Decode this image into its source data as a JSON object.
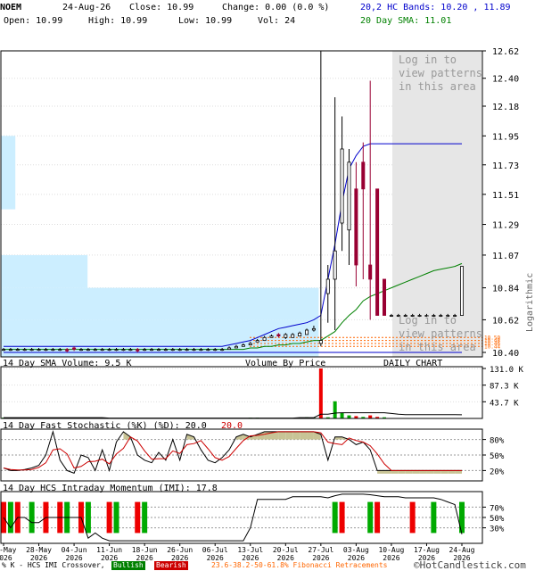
{
  "header": {
    "symbol": "NOEM",
    "date": "24-Aug-26",
    "close": "Close: 10.99",
    "change": "Change: 0.00 (0.0 %)",
    "open": "Open: 10.99",
    "high": "High: 10.99",
    "low": "Low: 10.99",
    "vol": "Vol: 24",
    "bands": "20,2 HC Bands: 10.20 , 11.89",
    "sma": "20 Day SMA: 11.01"
  },
  "panels": {
    "price": {
      "axis_label": "Logarithmic",
      "overlay_text": [
        "Log in to",
        "view patterns",
        "in this area"
      ],
      "y_ticks": [
        "12.62",
        "12.40",
        "12.18",
        "11.95",
        "11.73",
        "11.51",
        "11.29",
        "11.07",
        "10.84",
        "10.62",
        "10.40"
      ],
      "fib_labels": [
        "10.50",
        "10.48",
        "10.46",
        "10.44"
      ]
    },
    "volume": {
      "title": "14 Day SMA Volume: 9.5 K",
      "vbp_label": "Volume By Price",
      "daily_label": "DAILY CHART",
      "y_ticks": [
        "131.0 K",
        "87.3 K",
        "43.7 K"
      ]
    },
    "stochastic": {
      "title": "14 Day Fast Stochastic (%K) (%D): 20.0",
      "title_value": "20.0",
      "y_ticks": [
        "80%",
        "50%",
        "20%"
      ]
    },
    "imi": {
      "title": "14 Day HCS Intraday Momentum (IMI): 17.8",
      "y_ticks": [
        "70%",
        "50%",
        "30%"
      ]
    }
  },
  "x_labels": [
    [
      "21-May",
      "2026"
    ],
    [
      "28-May",
      "2026"
    ],
    [
      "04-Jun",
      "2026"
    ],
    [
      "11-Jun",
      "2026"
    ],
    [
      "18-Jun",
      "2026"
    ],
    [
      "26-Jun",
      "2026"
    ],
    [
      "06-Jul",
      "2026"
    ],
    [
      "13-Jul",
      "2026"
    ],
    [
      "20-Jul",
      "2026"
    ],
    [
      "27-Jul",
      "2026"
    ],
    [
      "03-Aug",
      "2026"
    ],
    [
      "10-Aug",
      "2026"
    ],
    [
      "17-Aug",
      "2026"
    ],
    [
      "24-Aug",
      "2026"
    ]
  ],
  "footer": {
    "legend_prefix": "% K - HCS IMI Crossover,",
    "bullish": "Bullish",
    "bearish": "Bearish",
    "fib": "23.6-38.2-50-61.8% Fibonacci Retracements",
    "copyright": "©HotCandlestick.com"
  },
  "colors": {
    "bull": "#008000",
    "bear": "#cc0000",
    "band": "#0000cc",
    "sma": "#008000",
    "vbp": "#cceeff",
    "fib": "#ff6600",
    "stoch_fill": "#c8c496",
    "shade": "#e6e6e6"
  },
  "chart_data": [
    {
      "type": "candlestick",
      "scale": "log",
      "ylim": [
        10.4,
        12.62
      ],
      "dates": [
        "2026-05-21",
        "2026-05-22",
        "2026-05-26",
        "2026-05-27",
        "2026-05-28",
        "2026-05-29",
        "2026-06-01",
        "2026-06-02",
        "2026-06-03",
        "2026-06-04",
        "2026-06-05",
        "2026-06-08",
        "2026-06-09",
        "2026-06-10",
        "2026-06-11",
        "2026-06-12",
        "2026-06-15",
        "2026-06-16",
        "2026-06-17",
        "2026-06-18",
        "2026-06-19",
        "2026-06-22",
        "2026-06-23",
        "2026-06-24",
        "2026-06-25",
        "2026-06-26",
        "2026-06-29",
        "2026-06-30",
        "2026-07-01",
        "2026-07-02",
        "2026-07-06",
        "2026-07-07",
        "2026-07-08",
        "2026-07-09",
        "2026-07-10",
        "2026-07-13",
        "2026-07-14",
        "2026-07-15",
        "2026-07-16",
        "2026-07-17",
        "2026-07-20",
        "2026-07-21",
        "2026-07-22",
        "2026-07-23",
        "2026-07-24",
        "2026-07-27",
        "2026-07-28",
        "2026-07-29",
        "2026-07-30",
        "2026-07-31",
        "2026-08-03",
        "2026-08-04",
        "2026-08-05",
        "2026-08-06",
        "2026-08-07",
        "2026-08-10",
        "2026-08-11",
        "2026-08-12",
        "2026-08-13",
        "2026-08-14",
        "2026-08-17",
        "2026-08-18",
        "2026-08-19",
        "2026-08-20",
        "2026-08-21",
        "2026-08-24"
      ],
      "open": [
        10.42,
        10.42,
        10.42,
        10.42,
        10.42,
        10.42,
        10.42,
        10.42,
        10.42,
        10.42,
        10.43,
        10.42,
        10.42,
        10.42,
        10.42,
        10.42,
        10.42,
        10.42,
        10.42,
        10.42,
        10.42,
        10.42,
        10.42,
        10.42,
        10.42,
        10.42,
        10.42,
        10.42,
        10.42,
        10.42,
        10.42,
        10.42,
        10.42,
        10.43,
        10.44,
        10.45,
        10.47,
        10.48,
        10.5,
        10.52,
        10.5,
        10.5,
        10.51,
        10.52,
        10.55,
        10.46,
        10.8,
        10.9,
        11.3,
        11.25,
        11.55,
        11.75,
        11.0,
        11.55,
        10.9,
        10.65,
        10.65,
        10.65,
        10.65,
        10.65,
        10.65,
        10.65,
        10.65,
        10.65,
        10.65,
        10.65
      ],
      "close": [
        10.42,
        10.42,
        10.42,
        10.42,
        10.42,
        10.42,
        10.42,
        10.42,
        10.42,
        10.41,
        10.42,
        10.42,
        10.42,
        10.42,
        10.42,
        10.42,
        10.42,
        10.42,
        10.42,
        10.41,
        10.42,
        10.42,
        10.42,
        10.42,
        10.42,
        10.42,
        10.42,
        10.42,
        10.42,
        10.42,
        10.42,
        10.42,
        10.43,
        10.44,
        10.45,
        10.46,
        10.48,
        10.5,
        10.51,
        10.51,
        10.52,
        10.52,
        10.53,
        10.55,
        10.56,
        10.48,
        10.9,
        11.1,
        11.85,
        11.75,
        11.0,
        11.55,
        10.9,
        10.65,
        10.65,
        10.65,
        10.65,
        10.65,
        10.65,
        10.65,
        10.65,
        10.65,
        10.65,
        10.65,
        10.65,
        10.99
      ],
      "high": [
        10.43,
        10.43,
        10.43,
        10.43,
        10.43,
        10.43,
        10.43,
        10.43,
        10.43,
        10.43,
        10.44,
        10.43,
        10.43,
        10.43,
        10.43,
        10.43,
        10.43,
        10.43,
        10.43,
        10.43,
        10.43,
        10.43,
        10.43,
        10.43,
        10.43,
        10.43,
        10.43,
        10.43,
        10.43,
        10.43,
        10.43,
        10.43,
        10.44,
        10.45,
        10.46,
        10.47,
        10.49,
        10.51,
        10.52,
        10.53,
        10.53,
        10.53,
        10.54,
        10.56,
        10.58,
        12.62,
        11.0,
        12.25,
        12.1,
        11.85,
        11.75,
        11.9,
        12.38,
        11.55,
        10.9,
        10.66,
        10.66,
        10.66,
        10.66,
        10.66,
        10.66,
        10.66,
        10.66,
        10.66,
        10.66,
        10.99
      ],
      "low": [
        10.41,
        10.41,
        10.41,
        10.41,
        10.41,
        10.41,
        10.41,
        10.41,
        10.41,
        10.4,
        10.41,
        10.41,
        10.41,
        10.41,
        10.41,
        10.41,
        10.41,
        10.41,
        10.41,
        10.4,
        10.41,
        10.41,
        10.41,
        10.41,
        10.41,
        10.41,
        10.41,
        10.41,
        10.41,
        10.41,
        10.41,
        10.41,
        10.42,
        10.43,
        10.44,
        10.45,
        10.47,
        10.48,
        10.5,
        10.5,
        10.49,
        10.5,
        10.51,
        10.52,
        10.54,
        10.44,
        10.6,
        10.55,
        11.1,
        11.0,
        10.85,
        10.9,
        10.62,
        10.65,
        10.65,
        10.64,
        10.64,
        10.64,
        10.64,
        10.64,
        10.64,
        10.64,
        10.64,
        10.64,
        10.64,
        10.99
      ],
      "sma20": [
        10.42,
        10.42,
        10.42,
        10.42,
        10.42,
        10.42,
        10.42,
        10.42,
        10.42,
        10.42,
        10.42,
        10.42,
        10.42,
        10.42,
        10.42,
        10.42,
        10.42,
        10.42,
        10.42,
        10.42,
        10.42,
        10.42,
        10.42,
        10.42,
        10.42,
        10.42,
        10.42,
        10.42,
        10.42,
        10.42,
        10.42,
        10.42,
        10.42,
        10.42,
        10.42,
        10.43,
        10.43,
        10.44,
        10.44,
        10.45,
        10.45,
        10.46,
        10.46,
        10.47,
        10.48,
        10.48,
        10.51,
        10.54,
        10.6,
        10.65,
        10.69,
        10.75,
        10.78,
        10.8,
        10.82,
        10.84,
        10.86,
        10.88,
        10.9,
        10.92,
        10.94,
        10.96,
        10.97,
        10.98,
        10.99,
        11.01
      ],
      "upper_band": [
        10.44,
        10.44,
        10.44,
        10.44,
        10.44,
        10.44,
        10.44,
        10.44,
        10.44,
        10.44,
        10.44,
        10.44,
        10.44,
        10.44,
        10.44,
        10.44,
        10.44,
        10.44,
        10.44,
        10.44,
        10.44,
        10.44,
        10.44,
        10.44,
        10.44,
        10.44,
        10.44,
        10.44,
        10.44,
        10.44,
        10.44,
        10.44,
        10.45,
        10.46,
        10.47,
        10.48,
        10.5,
        10.52,
        10.54,
        10.56,
        10.57,
        10.58,
        10.59,
        10.6,
        10.62,
        10.65,
        10.9,
        11.15,
        11.45,
        11.7,
        11.8,
        11.87,
        11.89,
        11.89,
        11.89,
        11.89,
        11.89,
        11.89,
        11.89,
        11.89,
        11.89,
        11.89,
        11.89,
        11.89,
        11.89,
        11.89
      ],
      "lower_band": [
        10.4,
        10.4,
        10.4,
        10.4,
        10.4,
        10.4,
        10.4,
        10.4,
        10.4,
        10.4,
        10.4,
        10.4,
        10.4,
        10.4,
        10.4,
        10.4,
        10.4,
        10.4,
        10.4,
        10.4,
        10.4,
        10.4,
        10.4,
        10.4,
        10.4,
        10.4,
        10.4,
        10.4,
        10.4,
        10.4,
        10.4,
        10.4,
        10.4,
        10.4,
        10.4,
        10.4,
        10.4,
        10.4,
        10.4,
        10.4,
        10.4,
        10.4,
        10.4,
        10.4,
        10.4,
        10.4,
        10.4,
        10.4,
        10.4,
        10.4,
        10.4,
        10.4,
        10.4,
        10.4,
        10.4,
        10.4,
        10.4,
        10.4,
        10.4,
        10.4,
        10.4,
        10.4,
        10.4,
        10.4,
        10.4,
        10.2
      ],
      "volume_by_price": [
        {
          "price": 11.95,
          "share": 0.03
        },
        {
          "price": 11.4,
          "share": 0.0
        },
        {
          "price": 11.07,
          "share": 0.18
        },
        {
          "price": 10.84,
          "share": 0.66
        },
        {
          "price": 10.62,
          "share": 0.66
        },
        {
          "price": 10.45,
          "share": 0.66
        }
      ],
      "fib_levels": [
        10.5,
        10.48,
        10.46,
        10.44
      ]
    },
    {
      "type": "bar",
      "title": "14 Day SMA Volume: 9.5 K",
      "ylim": [
        0,
        131000
      ],
      "volume": [
        2000,
        1000,
        0,
        0,
        1000,
        0,
        0,
        0,
        0,
        0,
        1000,
        0,
        0,
        1000,
        0,
        0,
        0,
        0,
        0,
        1000,
        0,
        0,
        0,
        0,
        0,
        0,
        0,
        0,
        0,
        0,
        0,
        0,
        1000,
        1000,
        1000,
        2000,
        2000,
        1000,
        1000,
        1000,
        1000,
        1000,
        2000,
        3000,
        2000,
        131000,
        3000,
        45000,
        15000,
        8000,
        6000,
        4000,
        8000,
        4000,
        3000,
        1000,
        1000,
        1000,
        1000,
        1000,
        1000,
        1000,
        1000,
        1000,
        1000,
        24
      ],
      "volume_color": [
        "bull",
        "bull",
        "bull",
        "bull",
        "bull",
        "bull",
        "bull",
        "bull",
        "bull",
        "bear",
        "bull",
        "bull",
        "bull",
        "bull",
        "bull",
        "bull",
        "bull",
        "bull",
        "bull",
        "bear",
        "bull",
        "bull",
        "bull",
        "bull",
        "bull",
        "bull",
        "bull",
        "bull",
        "bull",
        "bull",
        "bull",
        "bull",
        "bull",
        "bull",
        "bull",
        "bull",
        "bull",
        "bull",
        "bull",
        "bull",
        "bull",
        "bull",
        "bull",
        "bull",
        "bull",
        "bear",
        "bull",
        "bull",
        "bull",
        "bull",
        "bear",
        "bull",
        "bear",
        "bear",
        "bull",
        "bull",
        "bull",
        "bull",
        "bull",
        "bull",
        "bull",
        "bull",
        "bull",
        "bull",
        "bull",
        "bull"
      ],
      "volume_sma": [
        2000,
        2000,
        2000,
        2000,
        2000,
        2000,
        2000,
        2000,
        2000,
        2000,
        2000,
        2000,
        2000,
        2000,
        2000,
        1000,
        1000,
        1000,
        1000,
        1000,
        1000,
        1000,
        1000,
        1000,
        1000,
        1000,
        1000,
        1000,
        1000,
        1000,
        1000,
        1000,
        1000,
        1000,
        1000,
        1000,
        1000,
        1000,
        1000,
        1000,
        1000,
        1000,
        2000,
        2000,
        2000,
        11000,
        11000,
        14000,
        15000,
        15000,
        15000,
        15000,
        15000,
        15000,
        15000,
        13000,
        11000,
        10000,
        10000,
        10000,
        10000,
        10000,
        10000,
        10000,
        10000,
        9500
      ]
    },
    {
      "type": "line",
      "title": "14 Day Fast Stochastic (%K) (%D): 20.0",
      "ylim": [
        0,
        100
      ],
      "k": [
        25,
        20,
        20,
        22,
        25,
        30,
        50,
        95,
        40,
        20,
        15,
        50,
        45,
        20,
        60,
        20,
        75,
        95,
        85,
        50,
        40,
        35,
        55,
        40,
        80,
        40,
        90,
        85,
        60,
        40,
        35,
        45,
        60,
        85,
        90,
        85,
        90,
        95,
        95,
        95,
        95,
        95,
        95,
        95,
        95,
        90,
        40,
        85,
        85,
        80,
        70,
        75,
        60,
        20,
        20,
        20,
        20,
        20,
        20,
        20,
        20,
        20,
        20,
        20,
        20,
        20
      ],
      "d": [
        25,
        22,
        21,
        21,
        22,
        26,
        35,
        60,
        62,
        52,
        25,
        28,
        37,
        38,
        42,
        33,
        52,
        63,
        85,
        77,
        58,
        42,
        43,
        43,
        58,
        53,
        70,
        72,
        78,
        62,
        45,
        40,
        47,
        63,
        78,
        87,
        88,
        90,
        93,
        95,
        95,
        95,
        95,
        95,
        95,
        93,
        75,
        72,
        70,
        83,
        78,
        75,
        68,
        52,
        33,
        20,
        20,
        20,
        20,
        20,
        20,
        20,
        20,
        20,
        20,
        20
      ]
    },
    {
      "type": "line",
      "title": "14 Day HCS Intraday Momentum (IMI): 17.8",
      "ylim": [
        0,
        100
      ],
      "imi": [
        50,
        30,
        50,
        50,
        40,
        40,
        50,
        50,
        50,
        50,
        50,
        50,
        10,
        20,
        10,
        5,
        5,
        5,
        5,
        5,
        5,
        5,
        5,
        5,
        5,
        5,
        5,
        5,
        5,
        5,
        5,
        5,
        5,
        5,
        5,
        30,
        85,
        85,
        85,
        85,
        85,
        90,
        90,
        90,
        90,
        90,
        88,
        92,
        95,
        95,
        95,
        95,
        94,
        92,
        90,
        90,
        90,
        88,
        88,
        88,
        88,
        88,
        85,
        80,
        75,
        17.8
      ],
      "bullish_crossovers": [
        1,
        4,
        9,
        12,
        16,
        20,
        47,
        52,
        61,
        65
      ],
      "bearish_crossovers": [
        0,
        2,
        6,
        8,
        11,
        15,
        19,
        48,
        53,
        58
      ]
    }
  ]
}
